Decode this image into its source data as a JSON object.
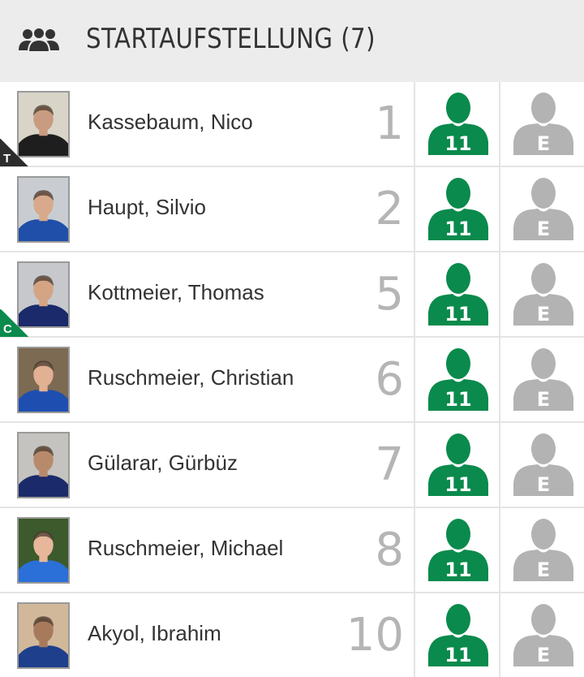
{
  "header": {
    "title": "STARTAUFSTELLUNG (7)",
    "icon": "team-icon"
  },
  "colors": {
    "starter_active": "#0a8a4c",
    "sub_inactive": "#b3b3b3",
    "number": "#b5b5b5",
    "captain_badge": "#0a8a4c",
    "trainer_badge": "#2d2d2d"
  },
  "players": [
    {
      "name": "Kassebaum, Nico",
      "number": "1",
      "badge": "T",
      "starter_label": "11",
      "sub_label": "E"
    },
    {
      "name": "Haupt, Silvio",
      "number": "2",
      "badge": "",
      "starter_label": "11",
      "sub_label": "E"
    },
    {
      "name": "Kottmeier, Thomas",
      "number": "5",
      "badge": "C",
      "starter_label": "11",
      "sub_label": "E"
    },
    {
      "name": "Ruschmeier, Christian",
      "number": "6",
      "badge": "",
      "starter_label": "11",
      "sub_label": "E"
    },
    {
      "name": "Gülarar, Gürbüz",
      "number": "7",
      "badge": "",
      "starter_label": "11",
      "sub_label": "E"
    },
    {
      "name": "Ruschmeier, Michael",
      "number": "8",
      "badge": "",
      "starter_label": "11",
      "sub_label": "E"
    },
    {
      "name": "Akyol, Ibrahim",
      "number": "10",
      "badge": "",
      "starter_label": "11",
      "sub_label": "E"
    }
  ]
}
